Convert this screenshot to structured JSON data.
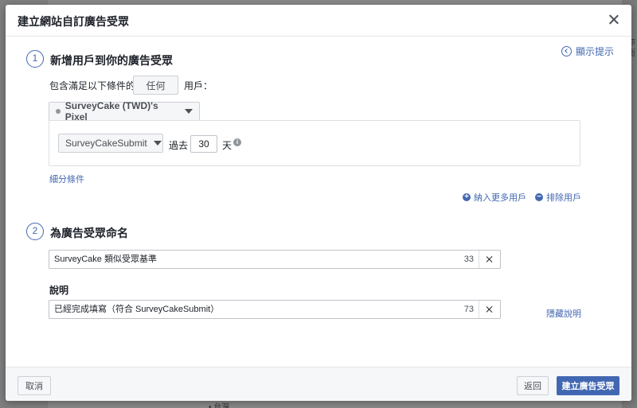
{
  "background": {
    "right_texts": [
      "你",
      "衛",
      "k"
    ],
    "bottom_text": "• 台灣"
  },
  "modal": {
    "title": "建立網站自訂廣告受眾",
    "hint_link": "顯示提示"
  },
  "step1": {
    "number": "1",
    "title": "新增用戶到你的廣告受眾",
    "include_prefix": "包含滿足以下條件的",
    "include_select": "任何",
    "include_suffix": "用戶：",
    "pixel_select": "SurveyCake (TWD)'s Pixel",
    "event_select": "SurveyCakeSubmit",
    "past_label": "過去",
    "days_value": "30",
    "days_unit": "天",
    "info_glyph": "i",
    "refine_link": "細分條件",
    "include_more": "納入更多用戶",
    "exclude_users": "排除用戶"
  },
  "step2": {
    "number": "2",
    "title": "為廣告受眾命名",
    "name_value": "SurveyCake 類似受眾基準",
    "name_count": "33",
    "desc_label": "說明",
    "desc_value": "已經完成填寫（符合 SurveyCakeSubmit）",
    "desc_count": "73",
    "hide_desc_link": "隱藏說明"
  },
  "footer": {
    "cancel": "取消",
    "back": "返回",
    "create": "建立廣告受眾"
  }
}
